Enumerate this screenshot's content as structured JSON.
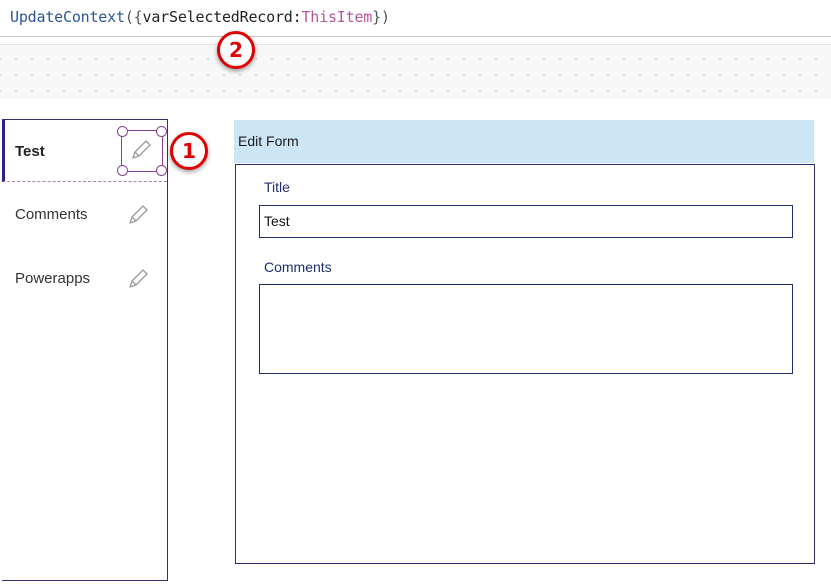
{
  "formula_bar": {
    "function_name": "UpdateContext",
    "open_paren": "(",
    "open_brace": "{",
    "variable": "varSelectedRecord",
    "colon": ":",
    "value": "ThisItem",
    "close_brace": "}",
    "close_paren": ")"
  },
  "gallery": {
    "items": [
      {
        "label": "Test",
        "selected": true,
        "icon": "pencil-icon"
      },
      {
        "label": "Comments",
        "selected": false,
        "icon": "pencil-icon"
      },
      {
        "label": "Powerapps",
        "selected": false,
        "icon": "pencil-icon"
      }
    ]
  },
  "callouts": [
    "1",
    "2"
  ],
  "form": {
    "header": "Edit Form",
    "fields": [
      {
        "label": "Title",
        "value": "Test"
      },
      {
        "label": "Comments",
        "value": ""
      }
    ]
  },
  "colors": {
    "callout": "#e00000",
    "form_header_bg": "#cde6f5",
    "gallery_accent": "#2e2480",
    "selection": "#8a3f9a"
  }
}
